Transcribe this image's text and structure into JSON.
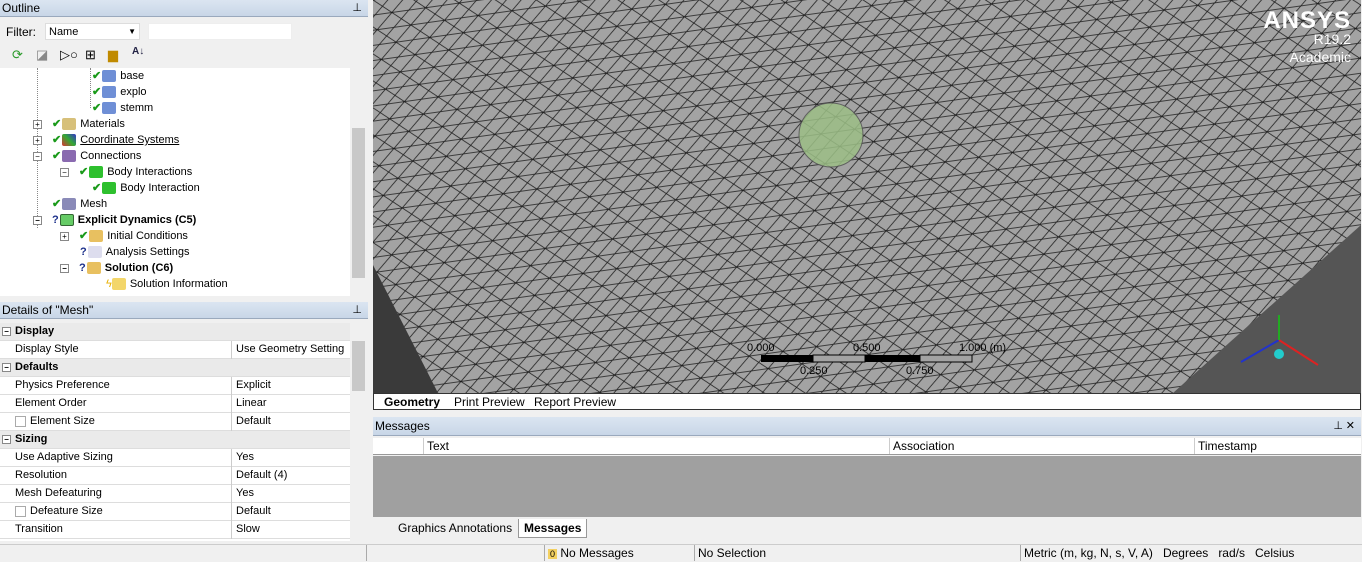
{
  "outline": {
    "title": "Outline",
    "filter_label": "Filter:",
    "filter_value": "Name",
    "search_value": "",
    "tree": [
      {
        "label": "base",
        "status": "check",
        "bold": false
      },
      {
        "label": "explo",
        "status": "check",
        "bold": false
      },
      {
        "label": "stemm",
        "status": "check",
        "bold": false
      },
      {
        "label": "Materials",
        "status": "check",
        "bold": false
      },
      {
        "label": "Coordinate Systems",
        "status": "check",
        "bold": false
      },
      {
        "label": "Connections",
        "status": "check",
        "bold": false
      },
      {
        "label": "Body Interactions",
        "status": "check",
        "bold": false
      },
      {
        "label": "Body Interaction",
        "status": "check",
        "bold": false
      },
      {
        "label": "Mesh",
        "status": "check",
        "bold": false
      },
      {
        "label": "Explicit Dynamics (C5)",
        "status": "question",
        "bold": true
      },
      {
        "label": "Initial Conditions",
        "status": "check",
        "bold": false
      },
      {
        "label": "Analysis Settings",
        "status": "question",
        "bold": false
      },
      {
        "label": "Solution (C6)",
        "status": "question",
        "bold": true
      },
      {
        "label": "Solution Information",
        "status": "lightning",
        "bold": false
      }
    ]
  },
  "details": {
    "title": "Details of \"Mesh\"",
    "rows": [
      {
        "section": true,
        "key": "Display"
      },
      {
        "key": "Display Style",
        "value": "Use Geometry Setting"
      },
      {
        "section": true,
        "key": "Defaults"
      },
      {
        "key": "Physics Preference",
        "value": "Explicit"
      },
      {
        "key": "Element Order",
        "value": "Linear"
      },
      {
        "key": "Element Size",
        "value": "Default",
        "checkbox": true
      },
      {
        "section": true,
        "key": "Sizing"
      },
      {
        "key": "Use Adaptive Sizing",
        "value": "Yes"
      },
      {
        "key": "Resolution",
        "value": "Default (4)"
      },
      {
        "key": "Mesh Defeaturing",
        "value": "Yes"
      },
      {
        "key": "Defeature Size",
        "value": "Default",
        "checkbox": true
      },
      {
        "key": "Transition",
        "value": "Slow"
      }
    ]
  },
  "viewport": {
    "brand": "ANSYS",
    "version": "R19.2",
    "edition": "Academic",
    "scale": {
      "labels_top": [
        "0.000",
        "0.500",
        "1.000 (m)"
      ],
      "labels_bottom": [
        "0.250",
        "0.750"
      ]
    },
    "tabs": [
      "Geometry",
      "Print Preview",
      "Report Preview"
    ],
    "active_tab": "Geometry"
  },
  "messages": {
    "title": "Messages",
    "columns": [
      "Text",
      "Association",
      "Timestamp"
    ],
    "tabs": [
      "Graphics Annotations",
      "Messages"
    ]
  },
  "status": {
    "messages_count": "0",
    "messages": "No Messages",
    "selection": "No Selection",
    "units": "Metric (m, kg, N, s, V, A)",
    "angle": "Degrees",
    "angular_velocity": "rad/s",
    "temperature": "Celsius"
  },
  "colors": {
    "mesh_bg": "#a3a3a3",
    "header": "#cfdbea"
  }
}
